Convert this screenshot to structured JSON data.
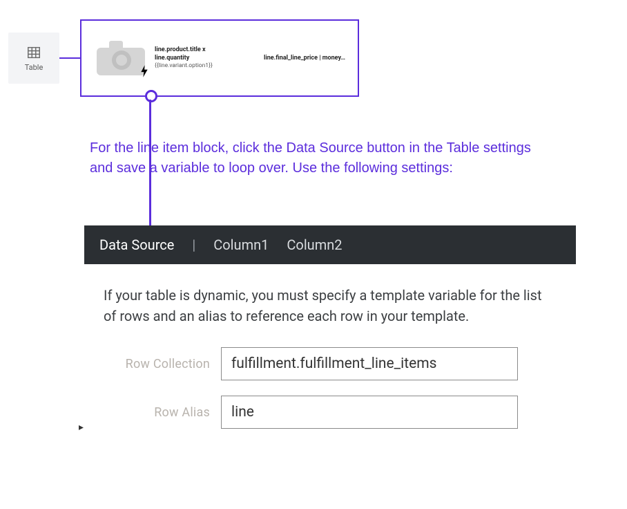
{
  "badge": {
    "label": "Table"
  },
  "line_item": {
    "title_line": "line.product.title  x",
    "qty_line": "line.quantity",
    "variant_line": "{{line.variant.option1}}",
    "price_line": "line.final_line_price | money…"
  },
  "caption": "For the line item block, click the Data Source button in the Table settings and save a variable to loop over. Use the following settings:",
  "panel": {
    "tabs": {
      "data_source": "Data Source",
      "separator": "|",
      "column1": "Column1",
      "column2": "Column2"
    },
    "description": "If your table is dynamic, you must specify a template variable for the list of rows and an alias to reference each row in your template.",
    "fields": {
      "row_collection": {
        "label": "Row Collection",
        "value": "fulfillment.fulfillment_line_items"
      },
      "row_alias": {
        "label": "Row Alias",
        "value": "line"
      }
    }
  }
}
